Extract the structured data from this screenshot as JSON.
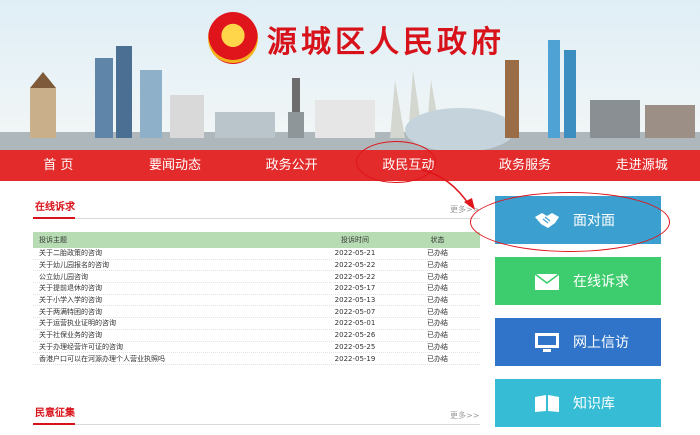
{
  "site": {
    "title": "源城区人民政府"
  },
  "nav": [
    "首 页",
    "要闻动态",
    "政务公开",
    "政民互动",
    "政务服务",
    "走进源城"
  ],
  "petition": {
    "title": "在线诉求",
    "more": "更多>>",
    "headers": [
      "投诉主题",
      "投诉时间",
      "状态"
    ],
    "rows": [
      [
        "关于二胎政策的咨询",
        "2022-05-21",
        "已办结"
      ],
      [
        "关于幼儿园报名的咨询",
        "2022-05-22",
        "已办结"
      ],
      [
        "公立幼儿园咨询",
        "2022-05-22",
        "已办结"
      ],
      [
        "关于提前退休的咨询",
        "2022-05-17",
        "已办结"
      ],
      [
        "关于小学入学的咨询",
        "2022-05-13",
        "已办结"
      ],
      [
        "关于两满特困的咨询",
        "2022-05-07",
        "已办结"
      ],
      [
        "关于运营执业证明的咨询",
        "2022-05-01",
        "已办结"
      ],
      [
        "关于社保业务的咨询",
        "2022-05-26",
        "已办结"
      ],
      [
        "关于办理经营许可证的咨询",
        "2022-05-25",
        "已办结"
      ],
      [
        "香港户口可以在河源办理个人营业执照吗",
        "2022-05-19",
        "已办结"
      ]
    ]
  },
  "opinion": {
    "title": "民意征集",
    "more": "更多>>"
  },
  "side_buttons": [
    {
      "label": "面对面",
      "color": "#3ba0cf",
      "icon": "handshake-icon"
    },
    {
      "label": "在线诉求",
      "color": "#3ecd6e",
      "icon": "envelope-icon"
    },
    {
      "label": "网上信访",
      "color": "#2f74c9",
      "icon": "monitor-icon"
    },
    {
      "label": "知识库",
      "color": "#36bcd4",
      "icon": "book-icon"
    }
  ]
}
